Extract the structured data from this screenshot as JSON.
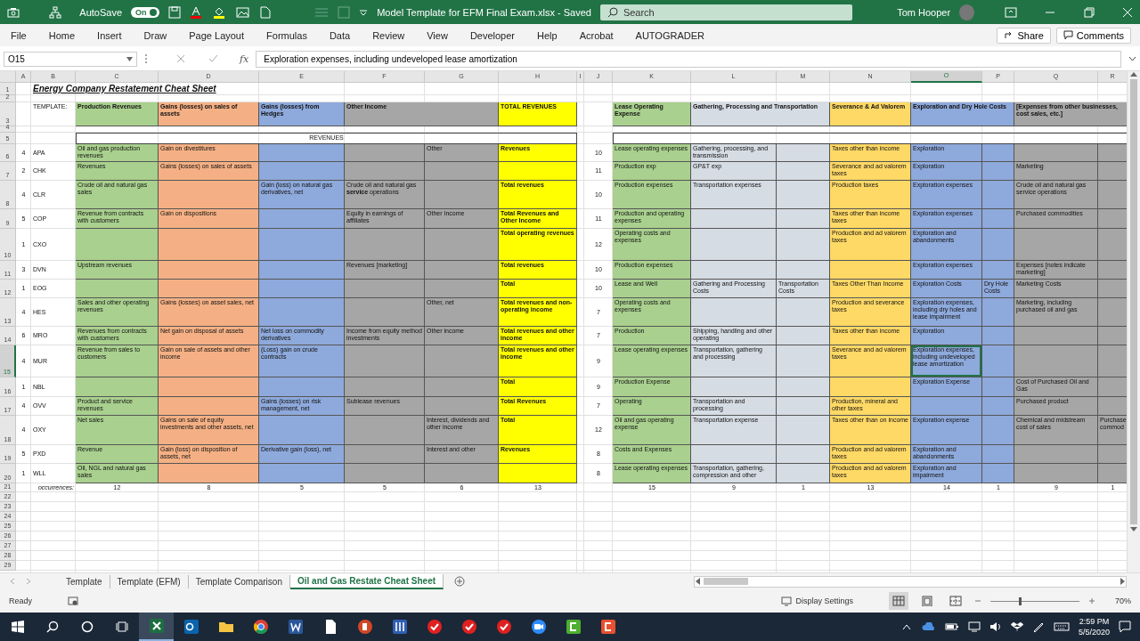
{
  "title_bar": {
    "autosave_label": "AutoSave",
    "autosave": {
      "label": "On",
      "on": true
    },
    "title": "Model Template for EFM Final Exam.xlsx - Saved",
    "search_placeholder": "Search",
    "user": "Tom Hooper"
  },
  "ribbon_tabs": [
    "File",
    "Home",
    "Insert",
    "Draw",
    "Page Layout",
    "Formulas",
    "Data",
    "Review",
    "View",
    "Developer",
    "Help",
    "Acrobat",
    "AUTOGRADER"
  ],
  "share": "Share",
  "comments": "Comments",
  "formula_bar": {
    "name_box": "O15",
    "fx": "fx",
    "value": "Exploration expenses, including undeveloped lease amortization"
  },
  "sheet": {
    "columns": [
      {
        "label": "A",
        "selected": false
      },
      {
        "label": "B",
        "selected": false
      },
      {
        "label": "C",
        "selected": false,
        "color": "#a9d08e"
      },
      {
        "label": "D",
        "selected": false,
        "color": "#f4b084"
      },
      {
        "label": "E",
        "selected": false,
        "color": "#8ea9db"
      },
      {
        "label": "F",
        "selected": false,
        "color": "#a6a6a6"
      },
      {
        "label": "G",
        "selected": false,
        "color": "#a6a6a6"
      },
      {
        "label": "H",
        "selected": false,
        "color": "#ffff00",
        "bold": true
      },
      {
        "label": "I",
        "selected": false
      },
      {
        "label": "J",
        "selected": false
      },
      {
        "label": "K",
        "selected": false,
        "color": "#a9d08e"
      },
      {
        "label": "L",
        "selected": false,
        "color": "#d6dce4"
      },
      {
        "label": "M",
        "selected": false,
        "color": "#d6dce4"
      },
      {
        "label": "N",
        "selected": false,
        "color": "#ffd966"
      },
      {
        "label": "O",
        "selected": true,
        "color": "#8ea9db"
      },
      {
        "label": "P",
        "selected": false,
        "color": "#8ea9db"
      },
      {
        "label": "Q",
        "selected": false,
        "color": "#a6a6a6"
      },
      {
        "label": "R",
        "selected": false,
        "color": "#a6a6a6"
      }
    ],
    "rows": [
      {
        "kind": "title",
        "label": "1",
        "selected": false,
        "text": "Energy Company Restatement Cheat Sheet"
      },
      {
        "kind": "blank",
        "label": "2",
        "selected": false
      },
      {
        "kind": "headers",
        "label": "3",
        "selected": false,
        "template_label": "TEMPLATE:",
        "revenue_headers": [
          {
            "text": "Production Revenues",
            "color": "#a9d08e"
          },
          {
            "text": "Gains (losses) on sales of assets",
            "color": "#f4b084"
          },
          {
            "text": "Gains (losses) from Hedges",
            "color": "#8ea9db"
          },
          {
            "text": "Other Income",
            "color": "#a6a6a6"
          },
          {
            "text": "TOTAL REVENUES",
            "color": "#ffff00"
          }
        ],
        "expense_headers": [
          {
            "text": "Lease Operating Expense",
            "color": "#a9d08e"
          },
          {
            "text": "Gathering, Processing and Transportation",
            "color": "#d6dce4"
          },
          {
            "text": "Severance & Ad Valorem",
            "color": "#ffd966"
          },
          {
            "text": "Exploration and Dry Hole Costs",
            "color": "#8ea9db"
          },
          {
            "text": "[Expenses from other businesses, cost sales, etc.]",
            "color": "#a6a6a6"
          }
        ]
      },
      {
        "kind": "blank",
        "label": "4",
        "selected": false
      },
      {
        "kind": "section",
        "label": "5",
        "selected": false,
        "heading": "REVENUES"
      },
      {
        "kind": "data",
        "label": "6",
        "selected": false,
        "count": "4",
        "ticker": "APA",
        "revenue": [
          {
            "kind": "text",
            "text": "Oil and gas production revenues"
          },
          {
            "kind": "text",
            "text": "Gain on divestitures"
          },
          {
            "kind": "blank"
          },
          {
            "kind": "blank"
          },
          {
            "kind": "text",
            "text": "Other"
          },
          {
            "kind": "text",
            "text": "Revenues"
          }
        ],
        "expense_count": "10",
        "expenses": [
          {
            "kind": "text",
            "text": "Lease operating expenses"
          },
          {
            "kind": "text",
            "text": "Gathering, processing, and transmission"
          },
          {
            "kind": "blank"
          },
          {
            "kind": "text",
            "text": "Taxes other than income"
          },
          {
            "kind": "text",
            "text": "Exploration"
          },
          {
            "kind": "blank"
          },
          {
            "kind": "blank"
          },
          {
            "kind": "blank"
          }
        ]
      },
      {
        "kind": "data",
        "label": "7",
        "selected": false,
        "count": "2",
        "ticker": "CHK",
        "revenue": [
          {
            "kind": "text",
            "text": "Revenues"
          },
          {
            "kind": "text",
            "text": "Gains (losses) on sales of assets"
          },
          {
            "kind": "blank"
          },
          {
            "kind": "blank"
          },
          {
            "kind": "blank"
          },
          {
            "kind": "blank"
          }
        ],
        "expense_count": "11",
        "expenses": [
          {
            "kind": "text",
            "text": "Production exp"
          },
          {
            "kind": "text",
            "text": "GP&T exp"
          },
          {
            "kind": "blank"
          },
          {
            "kind": "text",
            "text": "Severance and ad valorem taxes"
          },
          {
            "kind": "text",
            "text": "Exploration"
          },
          {
            "kind": "blank"
          },
          {
            "kind": "text",
            "text": "Marketing"
          },
          {
            "kind": "blank"
          }
        ]
      },
      {
        "kind": "data",
        "label": "8",
        "selected": false,
        "count": "4",
        "ticker": "CLR",
        "revenue": [
          {
            "kind": "text",
            "text": "Crude oil and natural gas sales"
          },
          {
            "kind": "blank"
          },
          {
            "kind": "text",
            "text": "Gain (loss) on natural gas derivatives, net"
          },
          {
            "kind": "text",
            "text": "Crude oil and natural gas **service** operations"
          },
          {
            "kind": "blank"
          },
          {
            "kind": "text",
            "text": "Total revenues"
          }
        ],
        "expense_count": "10",
        "expenses": [
          {
            "kind": "text",
            "text": "Production expenses"
          },
          {
            "kind": "text",
            "text": "Transportation expenses"
          },
          {
            "kind": "blank"
          },
          {
            "kind": "text",
            "text": "Production taxes"
          },
          {
            "kind": "text",
            "text": "Exploration expenses"
          },
          {
            "kind": "blank"
          },
          {
            "kind": "text",
            "text": "Crude oil and natural gas service operations"
          },
          {
            "kind": "blank"
          }
        ]
      },
      {
        "kind": "data",
        "label": "9",
        "selected": false,
        "count": "5",
        "ticker": "COP",
        "revenue": [
          {
            "kind": "text",
            "text": "Revenue from contracts with customers"
          },
          {
            "kind": "text",
            "text": "Gain on dispositions"
          },
          {
            "kind": "blank"
          },
          {
            "kind": "text",
            "text": "Equity in earnings of affiliates"
          },
          {
            "kind": "text",
            "text": "Other Income"
          },
          {
            "kind": "text",
            "text": "Total Revenues and Other Income"
          }
        ],
        "expense_count": "11",
        "expenses": [
          {
            "kind": "text",
            "text": "Production and operating expenses"
          },
          {
            "kind": "blank"
          },
          {
            "kind": "blank"
          },
          {
            "kind": "text",
            "text": "Taxes other than income taxes"
          },
          {
            "kind": "text",
            "text": "Exploration expenses"
          },
          {
            "kind": "blank"
          },
          {
            "kind": "text",
            "text": "Purchased commodities"
          },
          {
            "kind": "blank"
          }
        ]
      },
      {
        "kind": "data",
        "label": "10",
        "selected": false,
        "count": "1",
        "ticker": "CXO",
        "revenue": [
          {
            "kind": "blank"
          },
          {
            "kind": "blank"
          },
          {
            "kind": "blank"
          },
          {
            "kind": "blank"
          },
          {
            "kind": "blank"
          },
          {
            "kind": "text",
            "text": "Total operating revenues"
          }
        ],
        "expense_count": "12",
        "expenses": [
          {
            "kind": "text",
            "text": "Operating costs and expenses"
          },
          {
            "kind": "blank"
          },
          {
            "kind": "blank"
          },
          {
            "kind": "text",
            "text": "Production and ad valorem taxes"
          },
          {
            "kind": "text",
            "text": "Exploration and abandonments"
          },
          {
            "kind": "blank"
          },
          {
            "kind": "blank"
          },
          {
            "kind": "blank"
          }
        ]
      },
      {
        "kind": "data",
        "label": "11",
        "selected": false,
        "count": "3",
        "ticker": "DVN",
        "revenue": [
          {
            "kind": "text",
            "text": "Upstream revenues"
          },
          {
            "kind": "blank"
          },
          {
            "kind": "blank"
          },
          {
            "kind": "text",
            "text": "Revenues  [marketing]"
          },
          {
            "kind": "blank"
          },
          {
            "kind": "text",
            "text": "Total revenues"
          }
        ],
        "expense_count": "10",
        "expenses": [
          {
            "kind": "text",
            "text": "Production expenses"
          },
          {
            "kind": "blank"
          },
          {
            "kind": "blank"
          },
          {
            "kind": "blank"
          },
          {
            "kind": "text",
            "text": "Exploration expenses"
          },
          {
            "kind": "blank"
          },
          {
            "kind": "text",
            "text": "Expenses [notes indicate marketing]"
          },
          {
            "kind": "blank"
          }
        ]
      },
      {
        "kind": "data",
        "label": "12",
        "selected": false,
        "count": "1",
        "ticker": "EOG",
        "revenue": [
          {
            "kind": "blank"
          },
          {
            "kind": "blank"
          },
          {
            "kind": "blank"
          },
          {
            "kind": "blank"
          },
          {
            "kind": "blank"
          },
          {
            "kind": "text",
            "text": "Total"
          }
        ],
        "expense_count": "10",
        "expenses": [
          {
            "kind": "text",
            "text": "Lease and Well"
          },
          {
            "kind": "text",
            "text": "Gathering and Processing Costs"
          },
          {
            "kind": "text",
            "text": "Transportation Costs"
          },
          {
            "kind": "text",
            "text": "Taxes Other Than Income"
          },
          {
            "kind": "text",
            "text": "Exploration Costs"
          },
          {
            "kind": "text",
            "text": "Dry Hole Costs"
          },
          {
            "kind": "text",
            "text": "Marketing Costs"
          },
          {
            "kind": "blank"
          }
        ]
      },
      {
        "kind": "data",
        "label": "13",
        "selected": false,
        "count": "4",
        "ticker": "HES",
        "revenue": [
          {
            "kind": "text",
            "text": "Sales and other operating revenues"
          },
          {
            "kind": "text",
            "text": "Gains (losses) on asset sales, net"
          },
          {
            "kind": "blank"
          },
          {
            "kind": "blank"
          },
          {
            "kind": "text",
            "text": "Other, net"
          },
          {
            "kind": "text",
            "text": "Total revenues and non-operating income"
          }
        ],
        "expense_count": "7",
        "expenses": [
          {
            "kind": "text",
            "text": "Operating costs and expenses"
          },
          {
            "kind": "blank"
          },
          {
            "kind": "blank"
          },
          {
            "kind": "text",
            "text": "Production and severance taxes"
          },
          {
            "kind": "text",
            "text": "Exploration expenses, including dry holes and lease impairment"
          },
          {
            "kind": "blank"
          },
          {
            "kind": "text",
            "text": "Marketing, including purchased oil and gas"
          },
          {
            "kind": "blank"
          }
        ]
      },
      {
        "kind": "data",
        "label": "14",
        "selected": false,
        "count": "6",
        "ticker": "MRO",
        "revenue": [
          {
            "kind": "text",
            "text": "Revenues from contracts with customers"
          },
          {
            "kind": "text",
            "text": "Net gain on disposal of assets"
          },
          {
            "kind": "text",
            "text": "Net loss on commodity derivatives"
          },
          {
            "kind": "text",
            "text": "Income from equity method investments"
          },
          {
            "kind": "text",
            "text": "Other income"
          },
          {
            "kind": "text",
            "text": "Total revenues and other income"
          }
        ],
        "expense_count": "7",
        "expenses": [
          {
            "kind": "text",
            "text": "Production"
          },
          {
            "kind": "text",
            "text": "Shipping, handling and other operating"
          },
          {
            "kind": "blank"
          },
          {
            "kind": "text",
            "text": "Taxes other than income"
          },
          {
            "kind": "text",
            "text": "Exploration"
          },
          {
            "kind": "blank"
          },
          {
            "kind": "blank"
          },
          {
            "kind": "blank"
          }
        ]
      },
      {
        "kind": "data",
        "label": "15",
        "selected": true,
        "count": "4",
        "ticker": "MUR",
        "revenue": [
          {
            "kind": "text",
            "text": "Revenue from sales to customers"
          },
          {
            "kind": "text",
            "text": "Gain on sale of assets and other income"
          },
          {
            "kind": "text",
            "text": "(Loss) gain on crude contracts"
          },
          {
            "kind": "blank"
          },
          {
            "kind": "blank"
          },
          {
            "kind": "text",
            "text": "Total revenues and other income"
          }
        ],
        "expense_count": "9",
        "expenses": [
          {
            "kind": "text",
            "text": "Lease operating expenses"
          },
          {
            "kind": "text",
            "text": "Transportation, gathering and processing"
          },
          {
            "kind": "blank"
          },
          {
            "kind": "text",
            "text": "Severance and ad valorem taxes"
          },
          {
            "kind": "text",
            "text": "Exploration expenses, including undeveloped lease amortization"
          },
          {
            "kind": "blank"
          },
          {
            "kind": "blank"
          },
          {
            "kind": "blank"
          }
        ]
      },
      {
        "kind": "data",
        "label": "16",
        "selected": false,
        "count": "1",
        "ticker": "NBL",
        "revenue": [
          {
            "kind": "blank"
          },
          {
            "kind": "blank"
          },
          {
            "kind": "blank"
          },
          {
            "kind": "blank"
          },
          {
            "kind": "blank"
          },
          {
            "kind": "text",
            "text": "Total"
          }
        ],
        "expense_count": "9",
        "expenses": [
          {
            "kind": "text",
            "text": "Production Expense"
          },
          {
            "kind": "blank"
          },
          {
            "kind": "blank"
          },
          {
            "kind": "blank"
          },
          {
            "kind": "text",
            "text": "Exploration Expense"
          },
          {
            "kind": "blank"
          },
          {
            "kind": "text",
            "text": "Cost of Purchased Oil and Gas"
          },
          {
            "kind": "blank"
          }
        ]
      },
      {
        "kind": "data",
        "label": "17",
        "selected": false,
        "count": "4",
        "ticker": "OVV",
        "revenue": [
          {
            "kind": "text",
            "text": "Product and service revenues"
          },
          {
            "kind": "blank"
          },
          {
            "kind": "text",
            "text": "Gains (losses) on risk management, net"
          },
          {
            "kind": "text",
            "text": "Sublease revenues"
          },
          {
            "kind": "blank"
          },
          {
            "kind": "text",
            "text": "Total Revenues"
          }
        ],
        "expense_count": "7",
        "expenses": [
          {
            "kind": "text",
            "text": "Operating"
          },
          {
            "kind": "text",
            "text": "Transportation and processing"
          },
          {
            "kind": "blank"
          },
          {
            "kind": "text",
            "text": "Production, mineral and other taxes"
          },
          {
            "kind": "blank"
          },
          {
            "kind": "blank"
          },
          {
            "kind": "text",
            "text": "Purchased product"
          },
          {
            "kind": "blank"
          }
        ]
      },
      {
        "kind": "data",
        "label": "18",
        "selected": false,
        "count": "4",
        "ticker": "OXY",
        "revenue": [
          {
            "kind": "text",
            "text": "Net sales"
          },
          {
            "kind": "text",
            "text": "Gains on sale of equity investments and other assets, net"
          },
          {
            "kind": "blank"
          },
          {
            "kind": "blank"
          },
          {
            "kind": "text",
            "text": "Interest, dividends and other income"
          },
          {
            "kind": "text",
            "text": "Total"
          }
        ],
        "expense_count": "12",
        "expenses": [
          {
            "kind": "text",
            "text": "Oil and gas operating expense"
          },
          {
            "kind": "text",
            "text": "Transportation expense"
          },
          {
            "kind": "blank"
          },
          {
            "kind": "text",
            "text": "Taxes other than on income"
          },
          {
            "kind": "text",
            "text": "Exploration expense"
          },
          {
            "kind": "blank"
          },
          {
            "kind": "text",
            "text": "Chemical and midstream cost of sales"
          },
          {
            "kind": "text",
            "text": "Purchase commod"
          }
        ]
      },
      {
        "kind": "data",
        "label": "19",
        "selected": false,
        "count": "5",
        "ticker": "PXD",
        "revenue": [
          {
            "kind": "text",
            "text": "Revenue"
          },
          {
            "kind": "text",
            "text": "Gain (loss) on disposition of assets, net"
          },
          {
            "kind": "text",
            "text": "Derivative gain (loss), net"
          },
          {
            "kind": "blank"
          },
          {
            "kind": "text",
            "text": "Interest and other"
          },
          {
            "kind": "text",
            "text": "Revenues"
          }
        ],
        "expense_count": "8",
        "expenses": [
          {
            "kind": "text",
            "text": "Costs and Expenses"
          },
          {
            "kind": "blank"
          },
          {
            "kind": "blank"
          },
          {
            "kind": "text",
            "text": "Production and ad valorem taxes"
          },
          {
            "kind": "text",
            "text": "Exploration and abandonments"
          },
          {
            "kind": "blank"
          },
          {
            "kind": "blank"
          },
          {
            "kind": "blank"
          }
        ]
      },
      {
        "kind": "data",
        "label": "20",
        "selected": false,
        "count": "1",
        "ticker": "WLL",
        "revenue": [
          {
            "kind": "text",
            "text": "Oil, NGL and natural gas sales"
          },
          {
            "kind": "blank"
          },
          {
            "kind": "blank"
          },
          {
            "kind": "blank"
          },
          {
            "kind": "blank"
          },
          {
            "kind": "blank"
          }
        ],
        "expense_count": "8",
        "expenses": [
          {
            "kind": "text",
            "text": "Lease operating expenses"
          },
          {
            "kind": "text",
            "text": "Transportation, gathering, compression and other"
          },
          {
            "kind": "blank"
          },
          {
            "kind": "text",
            "text": "Production and ad valorem taxes"
          },
          {
            "kind": "text",
            "text": "Exploration and impairment"
          },
          {
            "kind": "blank"
          },
          {
            "kind": "blank"
          },
          {
            "kind": "blank"
          }
        ]
      },
      {
        "kind": "totals",
        "label": "21",
        "selected": false,
        "text": "occurrences:",
        "revenue": [
          "12",
          "8",
          "5",
          "5",
          "6",
          "13"
        ],
        "expenses": [
          "15",
          "9",
          "1",
          "13",
          "14",
          "1",
          "9",
          "1"
        ]
      },
      {
        "kind": "blank",
        "label": "22",
        "selected": false
      },
      {
        "kind": "blank",
        "label": "23",
        "selected": false
      },
      {
        "kind": "blank",
        "label": "24",
        "selected": false
      },
      {
        "kind": "blank",
        "label": "25",
        "selected": false
      },
      {
        "kind": "blank",
        "label": "26",
        "selected": false
      },
      {
        "kind": "blank",
        "label": "27",
        "selected": false
      },
      {
        "kind": "blank",
        "label": "28",
        "selected": false
      },
      {
        "kind": "blank",
        "label": "29",
        "selected": false
      }
    ]
  },
  "sheet_tabs": [
    {
      "label": "Template",
      "selected": false
    },
    {
      "label": "Template (EFM)",
      "selected": false
    },
    {
      "label": "Template Comparison",
      "selected": false
    },
    {
      "label": "Oil and Gas Restate Cheat Sheet",
      "selected": true
    }
  ],
  "status_bar": {
    "status": "Ready",
    "display_settings": "Display Settings",
    "views": [
      {
        "kind": "normal",
        "selected": true
      },
      {
        "kind": "page_layout",
        "selected": false
      },
      {
        "kind": "page_break",
        "selected": false
      }
    ],
    "zoom": {
      "level": 0.32,
      "reading": "70%"
    }
  },
  "taskbar": {
    "apps": [
      {
        "kind": "excel",
        "active": true
      },
      {
        "kind": "outlook",
        "active": false
      },
      {
        "kind": "folder",
        "active": false
      },
      {
        "kind": "chrome",
        "active": false
      },
      {
        "kind": "word",
        "active": false
      },
      {
        "kind": "file",
        "active": false
      },
      {
        "kind": "powerpoint",
        "active": false
      },
      {
        "kind": "tool",
        "active": false
      },
      {
        "kind": "check",
        "active": false
      },
      {
        "kind": "check",
        "active": false
      },
      {
        "kind": "check",
        "active": false
      },
      {
        "kind": "camera",
        "active": false
      },
      {
        "kind": "recorder",
        "active": false
      },
      {
        "kind": "editor",
        "active": false
      }
    ],
    "time": "2:59 PM",
    "date": "5/5/2020"
  }
}
